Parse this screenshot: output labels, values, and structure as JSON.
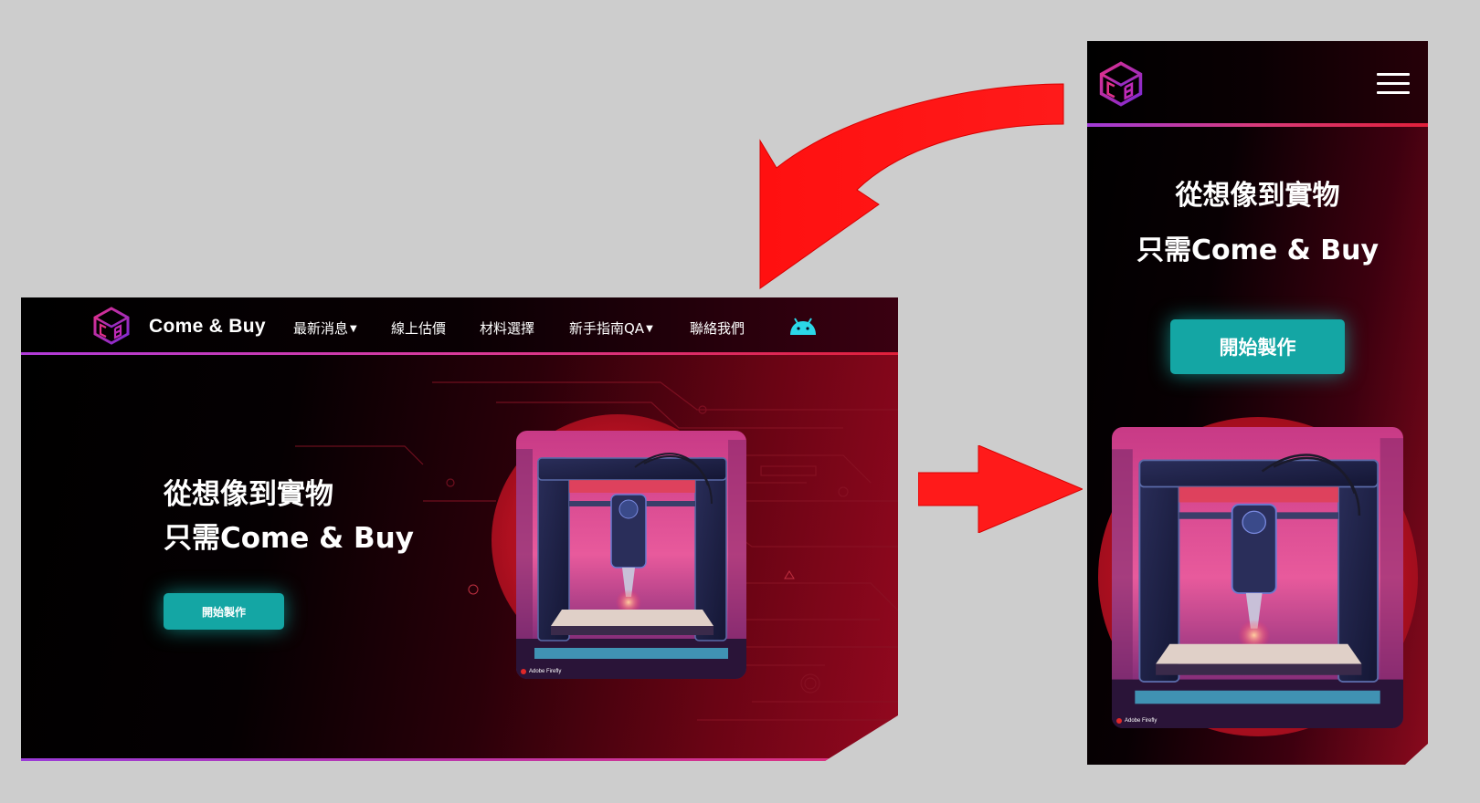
{
  "desktop": {
    "brand": "Come & Buy",
    "menu": [
      {
        "label": "最新消息",
        "has_dropdown": true
      },
      {
        "label": "線上估價",
        "has_dropdown": false
      },
      {
        "label": "材料選擇",
        "has_dropdown": false
      },
      {
        "label": "新手指南QA",
        "has_dropdown": true
      },
      {
        "label": "聯絡我們",
        "has_dropdown": false
      }
    ],
    "hero": {
      "line1": "從想像到實物",
      "line2": "只需Come & Buy",
      "cta": "開始製作"
    },
    "image_watermark": "Adobe Firefly"
  },
  "mobile": {
    "hero": {
      "line1": "從想像到實物",
      "line2": "只需Come & Buy",
      "cta": "開始製作"
    },
    "image_watermark": "Adobe Firefly"
  },
  "colors": {
    "accent_teal": "#14a6a4",
    "arrow_red": "#ff1a1a",
    "logo_pink": "#d8288a",
    "logo_purple": "#7a2ad8",
    "android_cyan": "#2bd8e8",
    "canvas_gray": "#cdcdcd"
  },
  "icons": [
    "cb-cube-logo-icon",
    "android-icon",
    "chevron-down-icon",
    "hamburger-menu-icon",
    "curved-arrow-icon",
    "right-arrow-icon"
  ]
}
